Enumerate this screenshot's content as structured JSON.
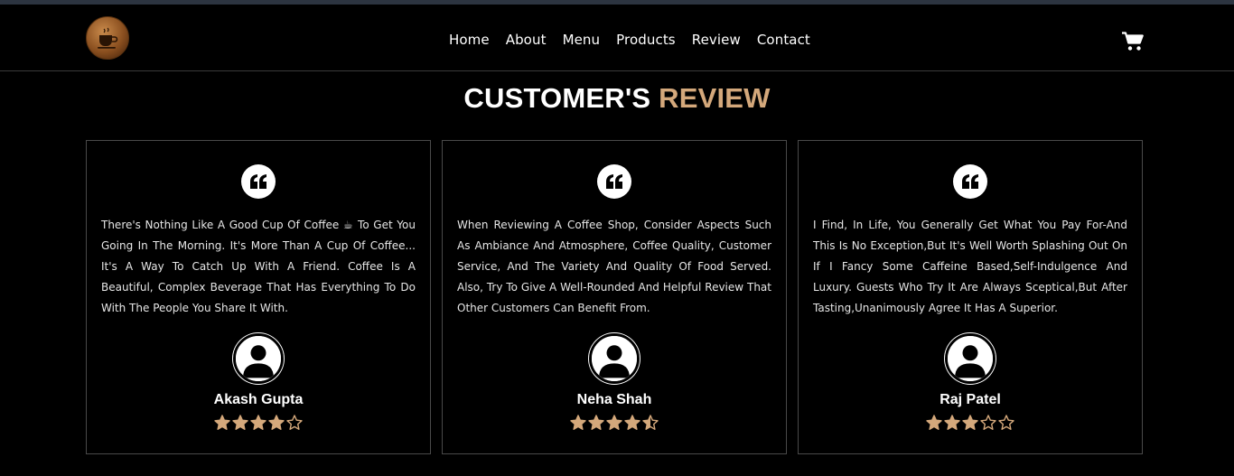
{
  "nav": {
    "items": [
      "Home",
      "About",
      "Menu",
      "Products",
      "Review",
      "Contact"
    ]
  },
  "heading": {
    "part1": "CUSTOMER'S",
    "part2": "REVIEW"
  },
  "colors": {
    "accent": "#d4a87b",
    "star": "#d4a87b",
    "background": "#000000"
  },
  "reviews": [
    {
      "text": "There's Nothing Like A Good Cup Of Coffee ☕ To Get You Going In The Morning. It's More Than A Cup Of Coffee... It's A Way To Catch Up With A Friend. Coffee Is A Beautiful, Complex Beverage That Has Everything To Do With The People You Share It With.",
      "name": "Akash Gupta",
      "rating": 4
    },
    {
      "text": "When Reviewing A Coffee Shop, Consider Aspects Such As Ambiance And Atmosphere, Coffee Quality, Customer Service, And The Variety And Quality Of Food Served. Also, Try To Give A Well-Rounded And Helpful Review That Other Customers Can Benefit From.",
      "name": "Neha Shah",
      "rating": 4.5
    },
    {
      "text": "I Find, In Life, You Generally Get What You Pay For-And This Is No Exception,But It's Well Worth Splashing Out On If I Fancy Some Caffeine Based,Self-Indulgence And Luxury. Guests Who Try It Are Always Sceptical,But After Tasting,Unanimously Agree It Has A Superior.",
      "name": "Raj Patel",
      "rating": 3
    }
  ]
}
